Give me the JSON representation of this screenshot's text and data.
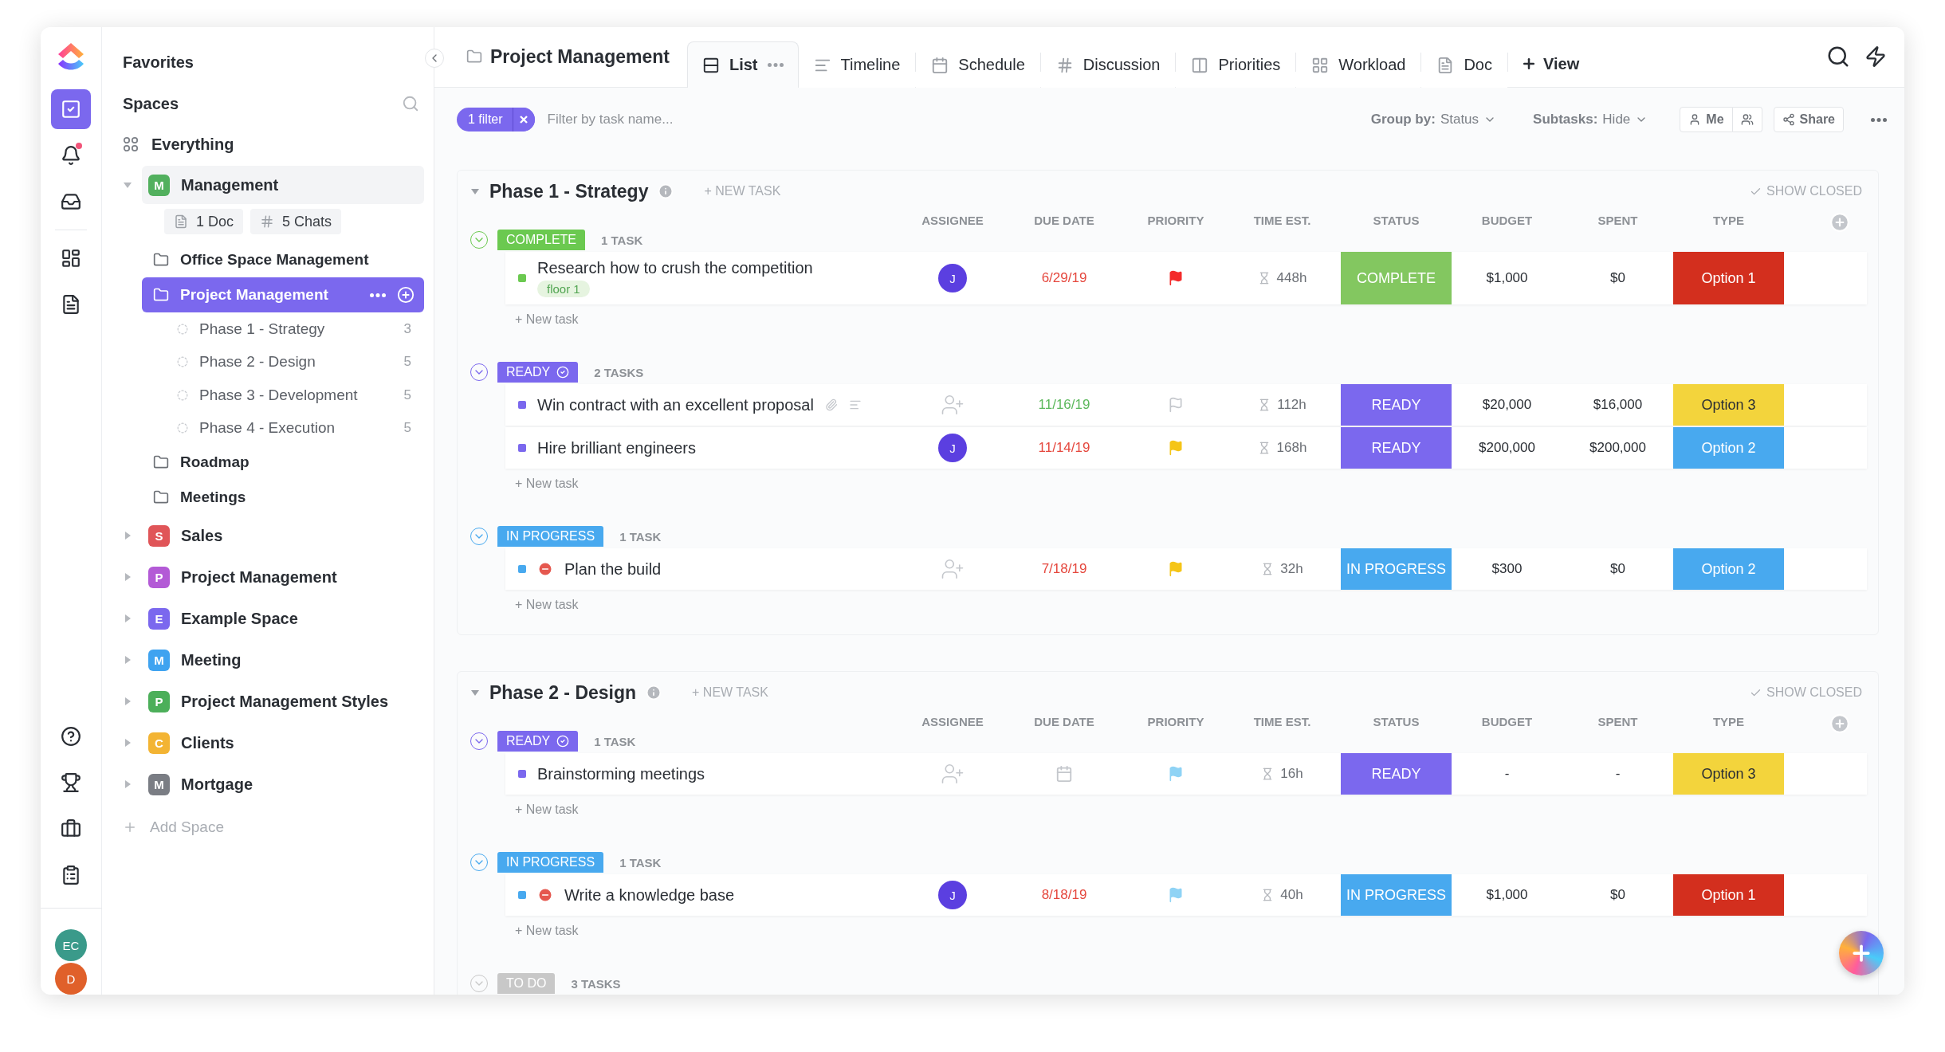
{
  "rail": {
    "top": [
      {
        "kind": "tasks",
        "selected": true,
        "unread": false
      },
      {
        "kind": "bell",
        "selected": false,
        "unread": true
      },
      {
        "kind": "inbox",
        "selected": false,
        "unread": false
      },
      {
        "kind": "dashboards",
        "selected": false,
        "unread": false
      },
      {
        "kind": "docs",
        "selected": false,
        "unread": false
      }
    ],
    "bottom": [
      {
        "kind": "help"
      },
      {
        "kind": "trophy"
      },
      {
        "kind": "briefcase"
      },
      {
        "kind": "clipboard"
      }
    ],
    "avatars": [
      {
        "initials": "EC",
        "color": "#3a9a8a"
      },
      {
        "initials": "D",
        "color": "#e0602a"
      }
    ]
  },
  "sidebar": {
    "favorites": "Favorites",
    "spaces_label": "Spaces",
    "everything": "Everything",
    "spaces": [
      {
        "letter": "M",
        "name": "Management",
        "color": "#52b05e",
        "expanded": true,
        "chips": [
          {
            "kind": "doc",
            "label": "1 Doc"
          },
          {
            "kind": "chat",
            "label": "5 Chats"
          }
        ],
        "children": [
          {
            "name": "Office Space Management",
            "selected": false
          },
          {
            "name": "Project Management",
            "selected": true,
            "children": [
              {
                "name": "Phase 1 - Strategy",
                "count": "3"
              },
              {
                "name": "Phase 2 - Design",
                "count": "5"
              },
              {
                "name": "Phase 3 - Development",
                "count": "5"
              },
              {
                "name": "Phase 4 - Execution",
                "count": "5"
              }
            ]
          },
          {
            "name": "Roadmap",
            "selected": false
          },
          {
            "name": "Meetings",
            "selected": false
          }
        ]
      },
      {
        "letter": "S",
        "name": "Sales",
        "color": "#e05558",
        "expanded": false
      },
      {
        "letter": "P",
        "name": "Project Management",
        "color": "#b35ad6",
        "expanded": false
      },
      {
        "letter": "E",
        "name": "Example Space",
        "color": "#7b68ee",
        "expanded": false
      },
      {
        "letter": "M",
        "name": "Meeting",
        "color": "#3fa3f0",
        "expanded": false
      },
      {
        "letter": "P",
        "name": "Project Management Styles",
        "color": "#4caf5a",
        "expanded": false
      },
      {
        "letter": "C",
        "name": "Clients",
        "color": "#f3b433",
        "expanded": false
      },
      {
        "letter": "M",
        "name": "Mortgage",
        "color": "#7a7d84",
        "expanded": false
      }
    ],
    "add_space": "Add Space"
  },
  "header": {
    "title": "Project Management",
    "views": [
      {
        "kind": "list",
        "label": "List",
        "selected": true
      },
      {
        "kind": "timeline",
        "label": "Timeline",
        "selected": false
      },
      {
        "kind": "schedule",
        "label": "Schedule",
        "selected": false
      },
      {
        "kind": "discussion",
        "label": "Discussion",
        "selected": false
      },
      {
        "kind": "priorities",
        "label": "Priorities",
        "selected": false
      },
      {
        "kind": "workload",
        "label": "Workload",
        "selected": false
      },
      {
        "kind": "doc",
        "label": "Doc",
        "selected": false
      }
    ],
    "add_view": "View"
  },
  "toolbar": {
    "filter_chip": "1 filter",
    "filter_placeholder": "Filter by task name...",
    "group_by": {
      "label": "Group by:",
      "value": "Status"
    },
    "subtasks": {
      "label": "Subtasks:",
      "value": "Hide"
    },
    "me": "Me",
    "share": "Share"
  },
  "phases": [
    {
      "name": "Phase 1 - Strategy",
      "expanded": true,
      "new_task": "+ NEW TASK",
      "show_closed": "SHOW CLOSED",
      "columns": [
        "ASSIGNEE",
        "DUE DATE",
        "PRIORITY",
        "TIME EST.",
        "STATUS",
        "BUDGET",
        "SPENT",
        "TYPE"
      ],
      "groups": [
        {
          "status": "COMPLETE",
          "color": "#6bc950",
          "verified": false,
          "count": "1 TASK",
          "new_task": "+ New task",
          "tasks": [
            {
              "name": "Research how to crush the competition",
              "tag": "floor 1",
              "blocked": false,
              "attachments": false,
              "assignee": "J",
              "due": {
                "text": "6/29/19",
                "color": "#e5483e"
              },
              "flag": {
                "color": "#f42c2c",
                "filled": true
              },
              "time": "448h",
              "status": {
                "label": "COMPLETE",
                "color": "#83c760"
              },
              "budget": "$1,000",
              "spent": "$0",
              "type": {
                "label": "Option 1",
                "color": "#d32f1e"
              }
            }
          ]
        },
        {
          "status": "READY",
          "color": "#7b68ee",
          "verified": true,
          "count": "2 TASKS",
          "new_task": "+ New task",
          "tasks": [
            {
              "name": "Win contract with an excellent proposal",
              "blocked": false,
              "attachments": true,
              "due": {
                "text": "11/16/19",
                "color": "#5cb85c"
              },
              "flag": {
                "color": "#c4c7cc",
                "filled": false
              },
              "time": "112h",
              "status": {
                "label": "READY",
                "color": "#7b68ee"
              },
              "budget": "$20,000",
              "spent": "$16,000",
              "type": {
                "label": "Option 3",
                "color": "#f3d43c"
              }
            },
            {
              "name": "Hire brilliant engineers",
              "blocked": false,
              "attachments": false,
              "assignee": "J",
              "due": {
                "text": "11/14/19",
                "color": "#e5483e"
              },
              "flag": {
                "color": "#f5c518",
                "filled": true
              },
              "time": "168h",
              "status": {
                "label": "READY",
                "color": "#7b68ee"
              },
              "budget": "$200,000",
              "spent": "$200,000",
              "type": {
                "label": "Option 2",
                "color": "#48a9ef"
              }
            }
          ]
        },
        {
          "status": "IN PROGRESS",
          "color": "#48a9ef",
          "verified": false,
          "count": "1 TASK",
          "new_task": "+ New task",
          "tasks": [
            {
              "name": "Plan the build",
              "blocked": true,
              "attachments": false,
              "due": {
                "text": "7/18/19",
                "color": "#e5483e"
              },
              "flag": {
                "color": "#f5c518",
                "filled": true
              },
              "time": "32h",
              "status": {
                "label": "IN PROGRESS",
                "color": "#48a9ef"
              },
              "budget": "$300",
              "spent": "$0",
              "type": {
                "label": "Option 2",
                "color": "#48a9ef"
              }
            }
          ]
        }
      ]
    },
    {
      "name": "Phase 2 - Design",
      "expanded": true,
      "new_task": "+ NEW TASK",
      "show_closed": "SHOW CLOSED",
      "columns": [
        "ASSIGNEE",
        "DUE DATE",
        "PRIORITY",
        "TIME EST.",
        "STATUS",
        "BUDGET",
        "SPENT",
        "TYPE"
      ],
      "groups": [
        {
          "status": "READY",
          "color": "#7b68ee",
          "verified": true,
          "count": "1 TASK",
          "new_task": "+ New task",
          "tasks": [
            {
              "name": "Brainstorming meetings",
              "blocked": false,
              "attachments": false,
              "flag": {
                "color": "#8fd3f5",
                "filled": true
              },
              "time": "16h",
              "status": {
                "label": "READY",
                "color": "#7b68ee"
              },
              "budget": "-",
              "spent": "-",
              "type": {
                "label": "Option 3",
                "color": "#f3d43c"
              }
            }
          ]
        },
        {
          "status": "IN PROGRESS",
          "color": "#48a9ef",
          "verified": false,
          "count": "1 TASK",
          "new_task": "+ New task",
          "tasks": [
            {
              "name": "Write a knowledge base",
              "blocked": true,
              "attachments": false,
              "assignee": "J",
              "due": {
                "text": "8/18/19",
                "color": "#e5483e"
              },
              "flag": {
                "color": "#8fd3f5",
                "filled": true
              },
              "time": "40h",
              "status": {
                "label": "IN PROGRESS",
                "color": "#48a9ef"
              },
              "budget": "$1,000",
              "spent": "$0",
              "type": {
                "label": "Option 1",
                "color": "#d32f1e"
              }
            }
          ]
        },
        {
          "status": "TO DO",
          "color": "#c8c8c8",
          "verified": false,
          "count": "3 TASKS"
        }
      ]
    }
  ]
}
